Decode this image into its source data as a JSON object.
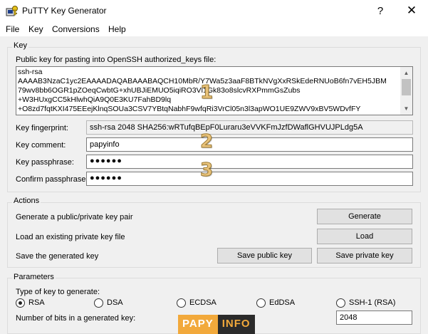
{
  "window": {
    "title": "PuTTY Key Generator",
    "help_glyph": "?",
    "close_glyph": "✕",
    "icon": "putty-keygen-icon"
  },
  "menu": [
    "File",
    "Key",
    "Conversions",
    "Help"
  ],
  "key_group": {
    "label": "Key",
    "public_key_label": "Public key for pasting into OpenSSH authorized_keys file:",
    "public_key_lines": [
      "ssh-rsa",
      "AAAAB3NzaC1yc2EAAAADAQABAAABAQCH10MbR/Y7Wa5z3aaF8BTkNVgXxRSkEdeRNUoB6fn7vEH5JBM",
      "79wv8bb6OGR1pZOeqCwbtG+xhUBJiEMUO5iqiRO3Vl1Gk83o8slcvRXPmmGsZubs",
      "+W3HUxgCC5kHlwhQiA9Q0E3KU7FahBD9lq",
      "+O8zd7fqtKXI475EEejKlnqSOUa3CSV7YBtqNabhF9wfqRi3VrCl05n3l3apWO1UE9ZWV9xBV5WDvfFY"
    ],
    "fingerprint_label": "Key fingerprint:",
    "fingerprint_value": "ssh-rsa 2048 SHA256:wRTufqBEpF0Luraru3eVVKFmJzfDWaflGHVUJPLdg5A",
    "comment_label": "Key comment:",
    "comment_value": "papyinfo",
    "passphrase_label": "Key passphrase:",
    "passphrase_value": "●●●●●●",
    "confirm_label": "Confirm passphrase:",
    "confirm_value": "●●●●●●"
  },
  "actions_group": {
    "label": "Actions",
    "generate_text": "Generate a public/private key pair",
    "generate_button": "Generate",
    "load_text": "Load an existing private key file",
    "load_button": "Load",
    "save_text": "Save the generated key",
    "save_public_button": "Save public key",
    "save_private_button": "Save private key"
  },
  "params_group": {
    "label": "Parameters",
    "type_label": "Type of key to generate:",
    "key_types": [
      "RSA",
      "DSA",
      "ECDSA",
      "EdDSA",
      "SSH-1 (RSA)"
    ],
    "selected_type": "RSA",
    "bits_label": "Number of bits in a generated key:",
    "bits_value": "2048"
  },
  "annotations": [
    "1",
    "2",
    "3"
  ],
  "watermark": {
    "part1": "PAPY",
    "part2": "INFO"
  },
  "colors": {
    "annotation": "#e8c27a",
    "watermark_orange": "#f2a93b",
    "watermark_dark": "#2b2b2b"
  }
}
